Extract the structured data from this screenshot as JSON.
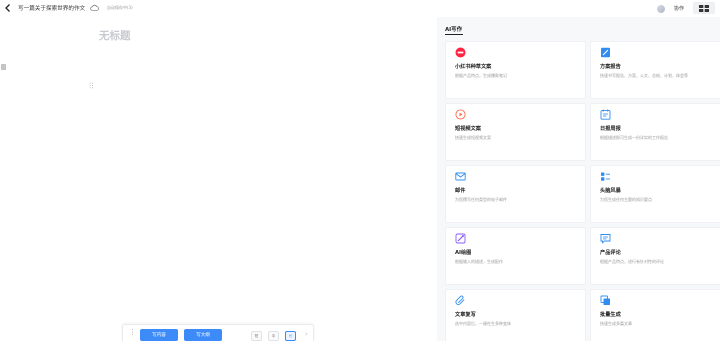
{
  "header": {
    "doc_title": "写一篇关于探索世界的作文",
    "autosave": "自动保存中(3)",
    "collab_label": "协作"
  },
  "editor": {
    "title_placeholder": "无标题"
  },
  "toolbar": {
    "more": "⋮",
    "write_content": "写内容",
    "write_outline": "写大纲",
    "length_short": "短",
    "length_medium": "中",
    "length_long": "长",
    "next": "›"
  },
  "panel": {
    "title": "AI写作",
    "cards": [
      {
        "title": "小红书种草文案",
        "desc": "根据产品特点，生成爆款笔记",
        "icon": "xiaohongshu-icon",
        "color": "#ff2442"
      },
      {
        "title": "方案报告",
        "desc": "快速书写报告、方案、公文、总结、计划、体会等",
        "icon": "report-icon",
        "color": "#2f8cf0"
      },
      {
        "title": "短视频文案",
        "desc": "快速生成短视频文案",
        "icon": "video-icon",
        "color": "#ff6a4d"
      },
      {
        "title": "日报周报",
        "desc": "根据描述即可生成一份详实的工作报告",
        "icon": "calendar-icon",
        "color": "#2f8cf0"
      },
      {
        "title": "邮件",
        "desc": "为您撰写任何类型的电子邮件",
        "icon": "mail-icon",
        "color": "#2f8cf0"
      },
      {
        "title": "头脑风暴",
        "desc": "为您生成任何主题的知识要点",
        "icon": "brainstorm-icon",
        "color": "#2f8cf0"
      },
      {
        "title": "AI绘图",
        "desc": "根据输入的描述，生成配作",
        "icon": "paint-icon",
        "color": "#8a5cf6"
      },
      {
        "title": "产品评论",
        "desc": "根据产品特点，进行有针对性的评论",
        "icon": "comment-icon",
        "color": "#2f8cf0"
      },
      {
        "title": "文章复写",
        "desc": "选中内容后，一键在生多种变体",
        "icon": "rewrite-icon",
        "color": "#2f8cf0"
      },
      {
        "title": "批量生成",
        "desc": "快速生成多篇文章",
        "icon": "batch-icon",
        "color": "#2f8cf0"
      }
    ]
  }
}
